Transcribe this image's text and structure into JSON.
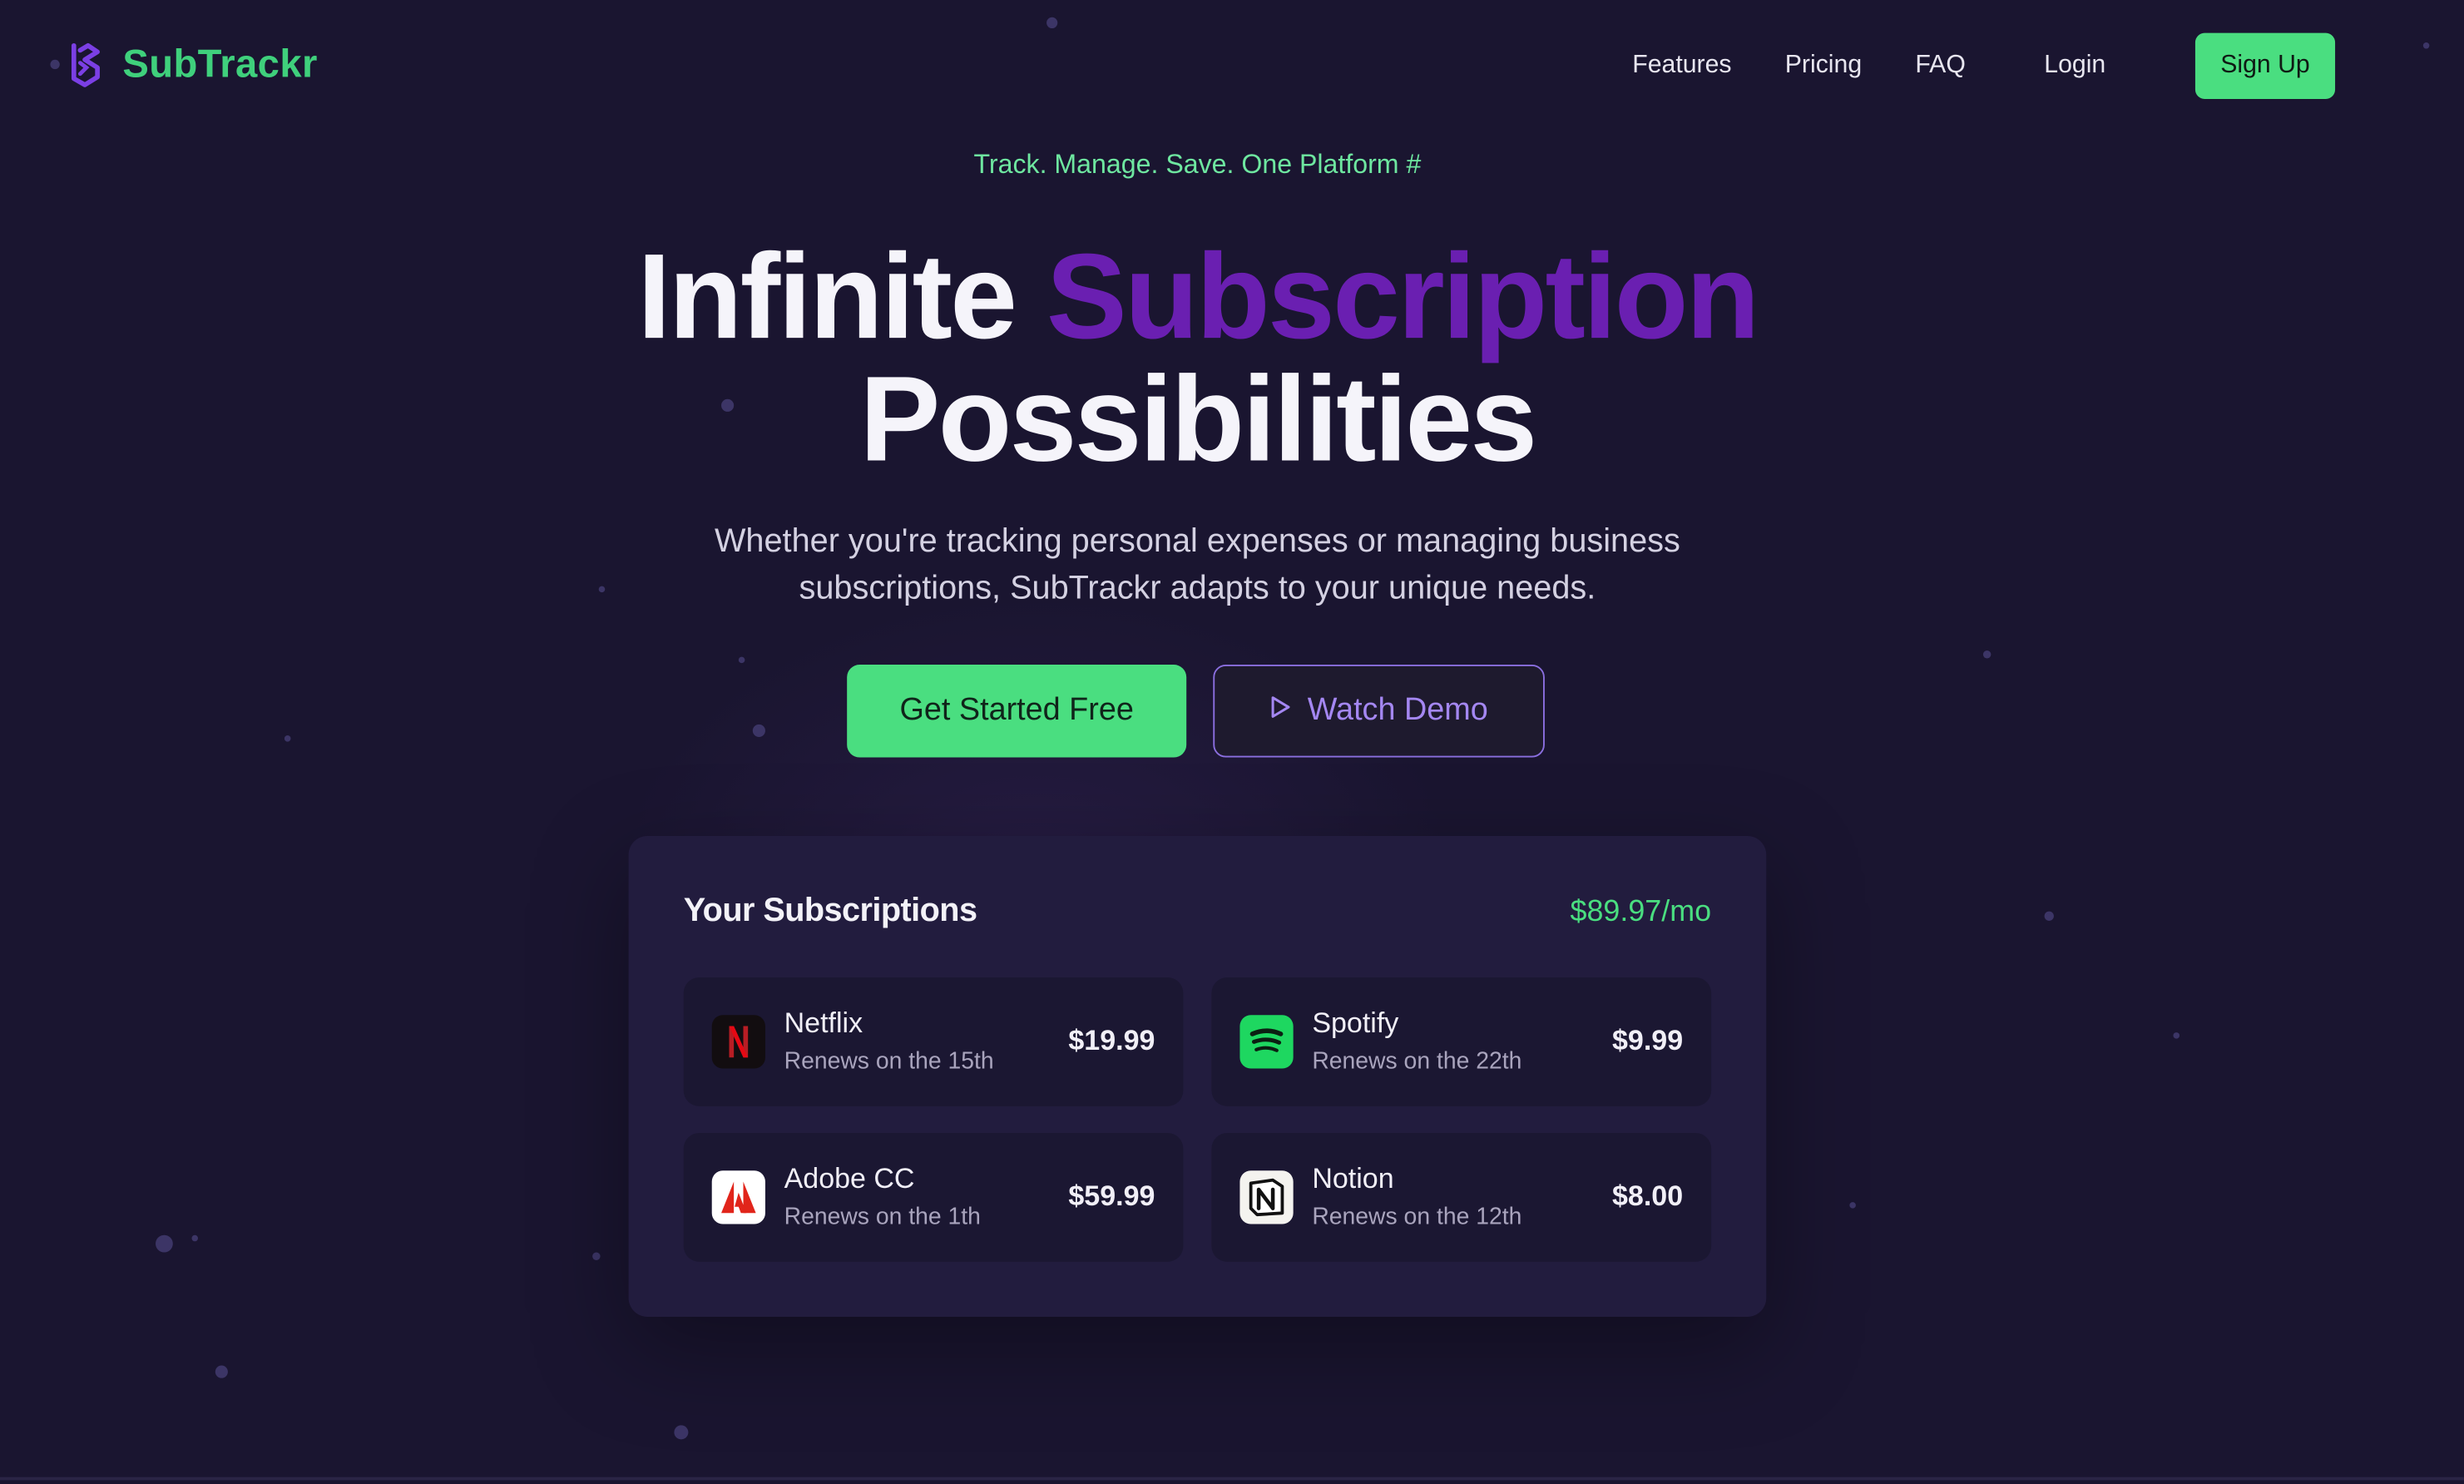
{
  "brand": {
    "name": "SubTrackr",
    "icon": "subtrackr-logo-icon",
    "color": "#3fd07c"
  },
  "nav": {
    "links": [
      "Features",
      "Pricing",
      "FAQ"
    ],
    "login": "Login",
    "signup": "Sign Up"
  },
  "hero": {
    "tagline": "Track. Manage. Save. One Platform #",
    "headline_part1": "Infinite",
    "headline_accent": "Subscription",
    "headline_part2": "Possibilities",
    "subtext_line1": "Whether you're tracking personal expenses or managing business",
    "subtext_line2": "subscriptions, SubTrackr adapts to your unique needs.",
    "primary_cta": "Get Started Free",
    "secondary_cta": "Watch Demo",
    "secondary_cta_icon": "play-icon"
  },
  "subscriptions": {
    "title": "Your Subscriptions",
    "total": "$89.97/mo",
    "items": [
      {
        "name": "Netflix",
        "renews": "Renews on the 15th",
        "price": "$19.99",
        "icon": "netflix-icon"
      },
      {
        "name": "Spotify",
        "renews": "Renews on the 22th",
        "price": "$9.99",
        "icon": "spotify-icon"
      },
      {
        "name": "Adobe CC",
        "renews": "Renews on the 1th",
        "price": "$59.99",
        "icon": "adobe-icon"
      },
      {
        "name": "Notion",
        "renews": "Renews on the 12th",
        "price": "$8.00",
        "icon": "notion-icon"
      }
    ]
  },
  "colors": {
    "background": "#1a1530",
    "accent_green": "#4ade80",
    "accent_purple": "#6a1fb1",
    "outline_purple": "#8b6fe0"
  }
}
